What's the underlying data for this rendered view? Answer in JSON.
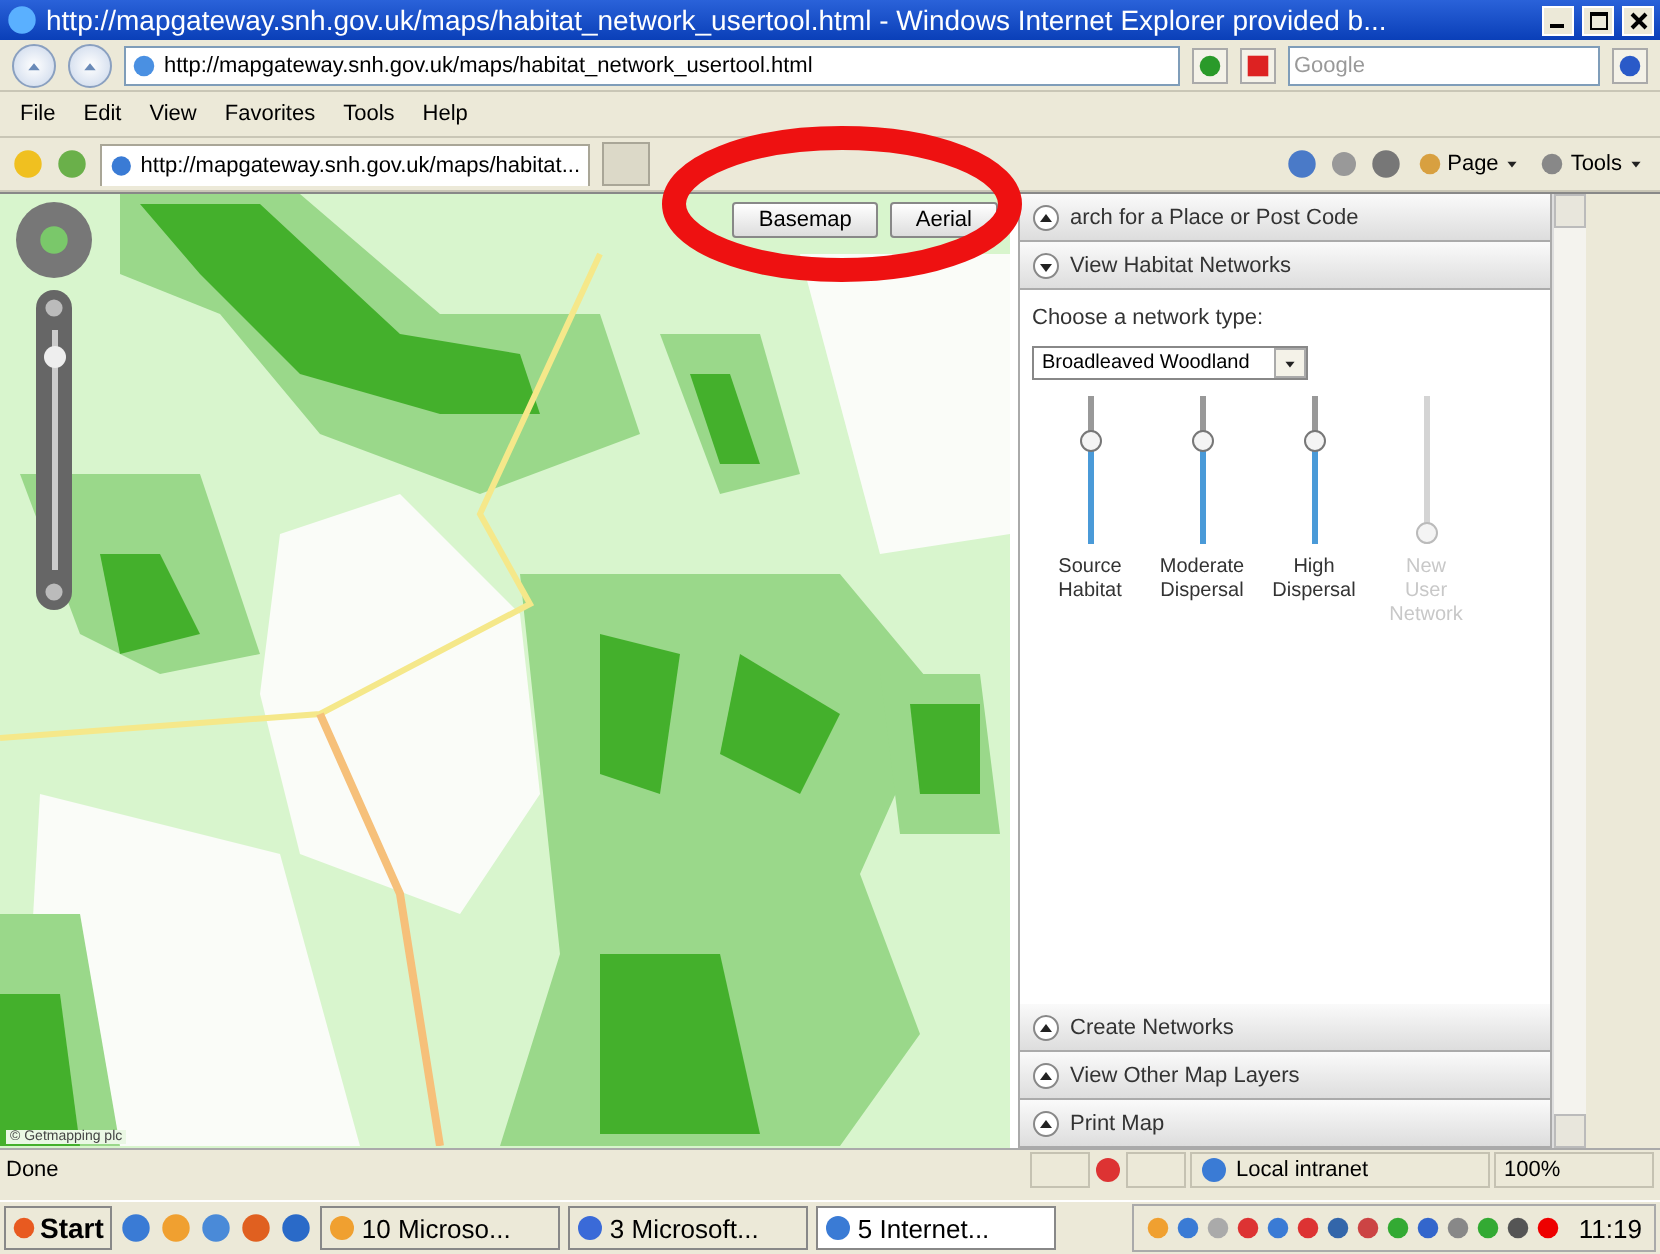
{
  "window": {
    "title": "http://mapgateway.snh.gov.uk/maps/habitat_network_usertool.html - Windows Internet Explorer provided b..."
  },
  "address_bar": {
    "value": "http://mapgateway.snh.gov.uk/maps/habitat_network_usertool.html"
  },
  "search": {
    "placeholder": "Google"
  },
  "menu": [
    "File",
    "Edit",
    "View",
    "Favorites",
    "Tools",
    "Help"
  ],
  "tabs": [
    {
      "label": "http://mapgateway.snh.gov.uk/maps/habitat...",
      "selected": true
    }
  ],
  "command_bar": [
    "Page",
    "Tools"
  ],
  "map": {
    "zoom": {
      "level": 0.88
    },
    "buttons": [
      {
        "label": "Basemap",
        "selected": false
      },
      {
        "label": "Aerial",
        "selected": false
      }
    ],
    "copyright": "© Getmapping plc"
  },
  "panel": {
    "sections": [
      {
        "title": "arch for a Place or Post Code",
        "expanded": false
      },
      {
        "title": "View Habitat Networks",
        "expanded": true
      }
    ],
    "network_label": "Choose a network type:",
    "network_type": "Broadleaved Woodland",
    "sliders": [
      {
        "label": "Source Habitat",
        "level": 0.73,
        "disabled": false
      },
      {
        "label": "Moderate Dispersal",
        "level": 0.73,
        "disabled": false
      },
      {
        "label": "High Dispersal",
        "level": 0.73,
        "disabled": false
      },
      {
        "label": "New User Network",
        "level": 0,
        "disabled": true
      }
    ],
    "bottom_sections": [
      {
        "title": "Create Networks",
        "expanded": false
      },
      {
        "title": "View Other Map Layers",
        "expanded": false
      },
      {
        "title": "Print Map",
        "expanded": false
      }
    ]
  },
  "status_bar": {
    "status": "Done",
    "zone": "Local intranet",
    "zoom": "100%"
  },
  "taskbar": {
    "start": "Start",
    "tasks": [
      {
        "label": "10 Microso...",
        "selected": false
      },
      {
        "label": "3 Microsoft...",
        "selected": false
      },
      {
        "label": "5 Internet...",
        "selected": true
      }
    ],
    "clock": "11:19"
  }
}
